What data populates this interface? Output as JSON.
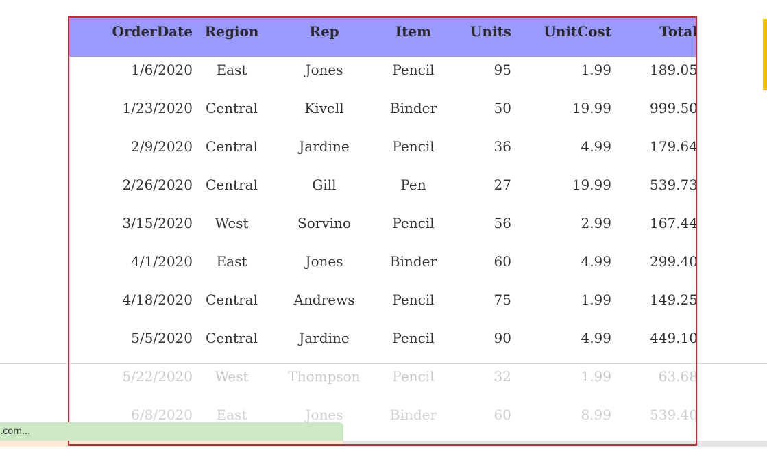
{
  "table": {
    "columns": [
      "OrderDate",
      "Region",
      "Rep",
      "Item",
      "Units",
      "UnitCost",
      "Total"
    ],
    "rows": [
      [
        "1/6/2020",
        "East",
        "Jones",
        "Pencil",
        "95",
        "1.99",
        "189.05"
      ],
      [
        "1/23/2020",
        "Central",
        "Kivell",
        "Binder",
        "50",
        "19.99",
        "999.50"
      ],
      [
        "2/9/2020",
        "Central",
        "Jardine",
        "Pencil",
        "36",
        "4.99",
        "179.64"
      ],
      [
        "2/26/2020",
        "Central",
        "Gill",
        "Pen",
        "27",
        "19.99",
        "539.73"
      ],
      [
        "3/15/2020",
        "West",
        "Sorvino",
        "Pencil",
        "56",
        "2.99",
        "167.44"
      ],
      [
        "4/1/2020",
        "East",
        "Jones",
        "Binder",
        "60",
        "4.99",
        "299.40"
      ],
      [
        "4/18/2020",
        "Central",
        "Andrews",
        "Pencil",
        "75",
        "1.99",
        "149.25"
      ],
      [
        "5/5/2020",
        "Central",
        "Jardine",
        "Pencil",
        "90",
        "4.99",
        "449.10"
      ],
      [
        "5/22/2020",
        "West",
        "Thompson",
        "Pencil",
        "32",
        "1.99",
        "63.68"
      ],
      [
        "6/8/2020",
        "East",
        "Jones",
        "Binder",
        "60",
        "8.99",
        "539.40"
      ]
    ]
  },
  "status": {
    "url_text": ".com..."
  },
  "colors": {
    "header_bg": "#9999ff",
    "frame_border": "#d8202a",
    "status_bg": "#cde8c5",
    "accent": "#f4c20d"
  }
}
